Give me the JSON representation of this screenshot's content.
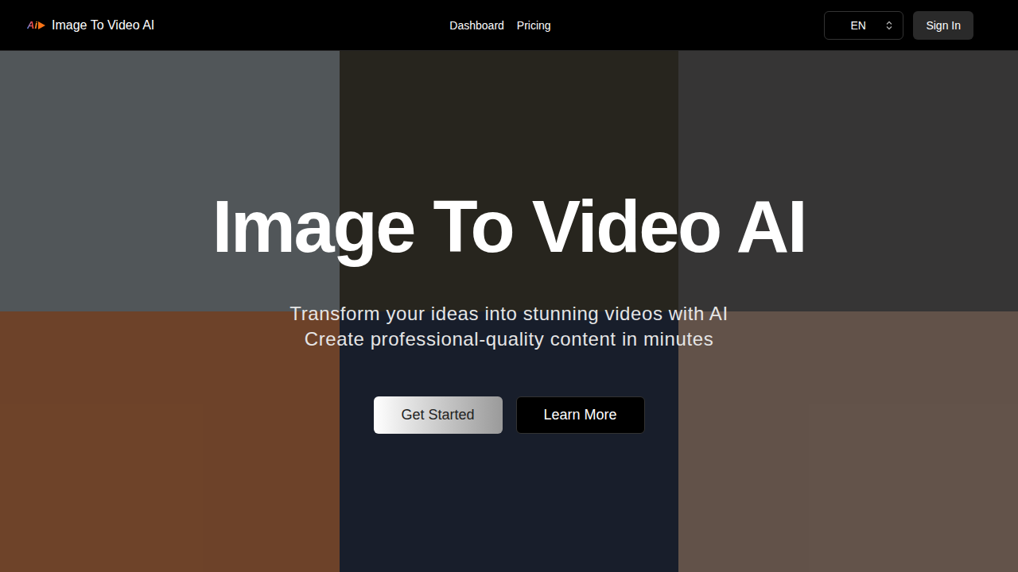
{
  "header": {
    "logo": {
      "text": "Ai"
    },
    "brand": "Image To Video AI",
    "nav": [
      {
        "label": "Dashboard"
      },
      {
        "label": "Pricing"
      }
    ],
    "language": "EN",
    "sign_in": "Sign In"
  },
  "hero": {
    "title": "Image To Video AI",
    "subtitle": [
      "Transform your ideas into stunning videos with AI",
      "Create professional-quality content in minutes"
    ],
    "buttons": [
      {
        "label": "Get Started",
        "kind": "primary"
      },
      {
        "label": "Learn More",
        "kind": "secondary"
      }
    ]
  },
  "videos": [
    {
      "color": "#5b6064"
    },
    {
      "color": "#2c2a22"
    },
    {
      "color": "#3d3b3b"
    },
    {
      "color": "#7a4a2e"
    },
    {
      "color": "#1b2230"
    },
    {
      "color": "#6e5c52"
    }
  ]
}
